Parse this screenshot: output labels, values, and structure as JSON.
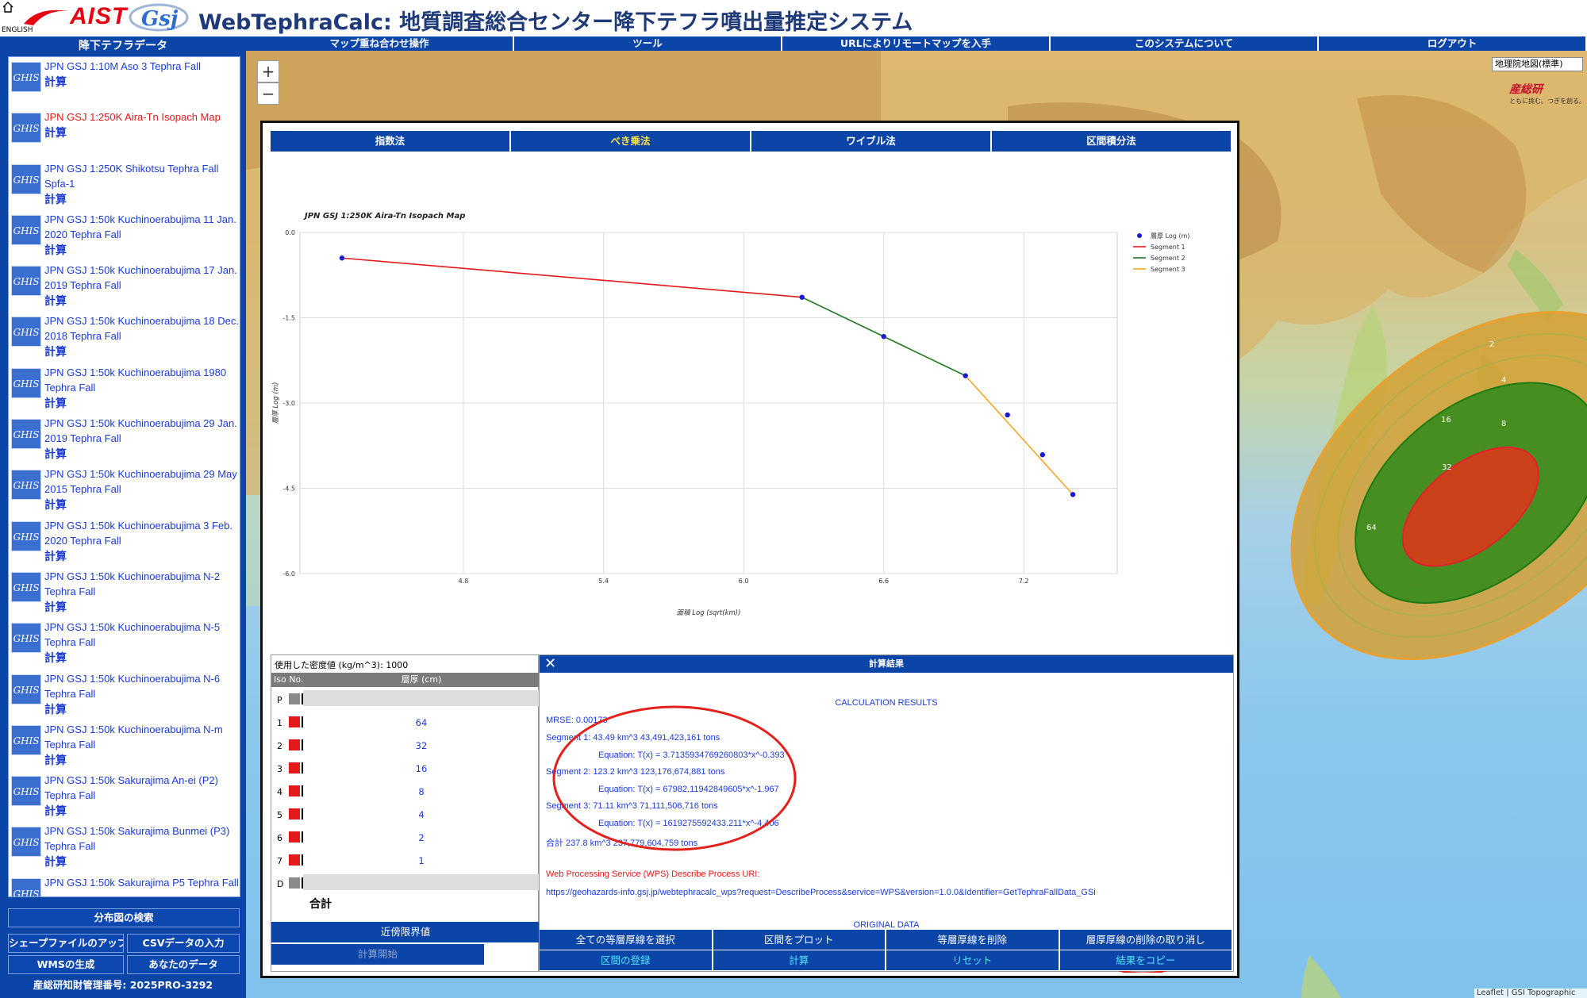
{
  "header": {
    "english_link": "ENGLISH",
    "aist_logo": "AIST",
    "title": "WebTephraCalc: 地質調査総合センター降下テフラ噴出量推定システム"
  },
  "sidebar": {
    "title": "降下テフラデータ",
    "calc_label": "計算",
    "icon_label": "GHIS",
    "datasets": [
      {
        "name": "JPN GSJ 1:10M Aso 3 Tephra Fall",
        "active": false
      },
      {
        "name": "JPN GSJ 1:250K Aira-Tn Isopach Map",
        "active": true
      },
      {
        "name": "JPN GSJ 1:250K Shikotsu Tephra Fall Spfa-1",
        "active": false
      },
      {
        "name": "JPN GSJ 1:50k Kuchinoerabujima 11 Jan. 2020 Tephra Fall",
        "active": false
      },
      {
        "name": "JPN GSJ 1:50k Kuchinoerabujima 17 Jan. 2019 Tephra Fall",
        "active": false
      },
      {
        "name": "JPN GSJ 1:50k Kuchinoerabujima 18 Dec. 2018 Tephra Fall",
        "active": false
      },
      {
        "name": "JPN GSJ 1:50k Kuchinoerabujima 1980 Tephra Fall",
        "active": false
      },
      {
        "name": "JPN GSJ 1:50k Kuchinoerabujima 29 Jan. 2019 Tephra Fall",
        "active": false
      },
      {
        "name": "JPN GSJ 1:50k Kuchinoerabujima 29 May 2015 Tephra Fall",
        "active": false
      },
      {
        "name": "JPN GSJ 1:50k Kuchinoerabujima 3 Feb. 2020 Tephra Fall",
        "active": false
      },
      {
        "name": "JPN GSJ 1:50k Kuchinoerabujima N-2 Tephra Fall",
        "active": false
      },
      {
        "name": "JPN GSJ 1:50k Kuchinoerabujima N-5 Tephra Fall",
        "active": false
      },
      {
        "name": "JPN GSJ 1:50k Kuchinoerabujima N-6 Tephra Fall",
        "active": false
      },
      {
        "name": "JPN GSJ 1:50k Kuchinoerabujima N-m Tephra Fall",
        "active": false
      },
      {
        "name": "JPN GSJ 1:50k Sakurajima An-ei (P2) Tephra Fall",
        "active": false
      },
      {
        "name": "JPN GSJ 1:50k Sakurajima Bunmei (P3) Tephra Fall",
        "active": false
      },
      {
        "name": "JPN GSJ 1:50k Sakurajima P5 Tephra Fall",
        "active": false
      }
    ],
    "search_button": "分布図の検索",
    "shapefile_button": "シェープファイルのアップロード",
    "csv_button": "CSVデータの入力",
    "wms_button": "WMSの生成",
    "your_data_button": "あなたのデータ",
    "license": "産総研知財管理番号: 2025PRO-3292"
  },
  "topnav": {
    "items": [
      "マップ重ね合わせ操作",
      "ツール",
      "URLによりリモートマップを入手",
      "このシステムについて",
      "ログアウト"
    ]
  },
  "map": {
    "zoom_in": "+",
    "zoom_out": "−",
    "basemap_selected": "地理院地図(標準)",
    "logo": "産総研",
    "logo_sub": "ともに挑む。つぎを創る。",
    "attribution": "Leaflet | GSI Topographic Map",
    "isopach_labels": [
      "2",
      "4",
      "8",
      "16",
      "32",
      "64"
    ],
    "colors": {
      "outer": "#d4a034",
      "middle": "#2e8a1a",
      "inner": "#d93a1a"
    }
  },
  "methods": {
    "tabs": [
      "指数法",
      "べき乗法",
      "ワイブル法",
      "区間積分法"
    ],
    "active_index": 1
  },
  "chart_data": {
    "type": "line",
    "title": "JPN GSJ 1:250K Aira-Tn Isopach Map",
    "xlabel": "面積 Log (sqrt(km))",
    "ylabel": "層厚 Log (m)",
    "xlim": [
      4.1,
      7.6
    ],
    "ylim": [
      -6.0,
      0.0
    ],
    "xticks": [
      "4.8",
      "5.4",
      "6.0",
      "6.6",
      "7.2"
    ],
    "xtick_values": [
      4.8,
      5.4,
      6.0,
      6.6,
      7.2
    ],
    "yticks": [
      "0.0",
      "-1.5",
      "-3.0",
      "-4.5",
      "-6.0"
    ],
    "ytick_values": [
      0.0,
      -1.5,
      -3.0,
      -4.5,
      -6.0
    ],
    "points": {
      "name": "層厚 Log (m)",
      "x": [
        4.28,
        6.25,
        6.6,
        6.95,
        7.13,
        7.28,
        7.41
      ],
      "y": [
        -0.45,
        -1.14,
        -1.83,
        -2.52,
        -3.21,
        -3.91,
        -4.61
      ],
      "color": "#1a1ad6"
    },
    "series": [
      {
        "name": "Segment 1",
        "color": "#e41a1a",
        "x": [
          4.28,
          6.25
        ],
        "y": [
          -0.45,
          -1.14
        ]
      },
      {
        "name": "Segment 2",
        "color": "#1f7a1f",
        "x": [
          6.25,
          6.95
        ],
        "y": [
          -1.14,
          -2.52
        ]
      },
      {
        "name": "Segment 3",
        "color": "#f5a623",
        "x": [
          6.95,
          7.41
        ],
        "y": [
          -2.52,
          -4.61
        ]
      }
    ],
    "legend": "top-right"
  },
  "iso_table": {
    "density": "使用した密度値 (kg/m^3): 1000",
    "col_no": "Iso No.",
    "col_thickness": "層厚 (cm)",
    "rows": [
      {
        "no": "P",
        "value": "",
        "swatch": "#8a8a8a"
      },
      {
        "no": "1",
        "value": "64",
        "swatch": "#e41a1a"
      },
      {
        "no": "2",
        "value": "32",
        "swatch": "#e41a1a"
      },
      {
        "no": "3",
        "value": "16",
        "swatch": "#e41a1a"
      },
      {
        "no": "4",
        "value": "8",
        "swatch": "#e41a1a"
      },
      {
        "no": "5",
        "value": "4",
        "swatch": "#e41a1a"
      },
      {
        "no": "6",
        "value": "2",
        "swatch": "#e41a1a"
      },
      {
        "no": "7",
        "value": "1",
        "swatch": "#e41a1a"
      },
      {
        "no": "D",
        "value": "",
        "swatch": "#8a8a8a"
      }
    ],
    "sum_label": "合計",
    "neighbor_button": "近傍限界値",
    "start_button": "計算開始"
  },
  "results": {
    "header": "計算結果",
    "close": "✕",
    "calc_title": "CALCULATION RESULTS",
    "mrse": "MRSE: 0.00173",
    "seg1": "Segment 1:  43.49 km^3    43,491,423,161 tons",
    "seg1_eq": "Equation: T(x) = 3.7135934769260803*x^-0.393",
    "seg2": "Segment 2:  123.2 km^3    123,176,674,881 tons",
    "seg2_eq": "Equation: T(x) = 67982.11942849605*x^-1.967",
    "seg3": "Segment 3:  71.11 km^3    71,111,506,716 tons",
    "seg3_eq": "Equation: T(x) = 1619275592433.211*x^-4.406",
    "total": "合計  237.8 km^3    237,779,604,759 tons",
    "wps_label": "Web Processing Service (WPS) Describe Process URI:",
    "wps_url": "https://geohazards-info.gsj.jp/webtephracalc_wps?request=DescribeProcess&service=WPS&version=1.0.0&Identifier=GetTephraFallData_GSi",
    "original_data": "ORIGINAL DATA",
    "buttons_row1": [
      "全ての等層厚線を選択",
      "区間をプロット",
      "等層厚線を削除",
      "層厚厚線の削除の取り消し"
    ],
    "buttons_row2": [
      "区間の登録",
      "計算",
      "リセット",
      "結果をコピー"
    ]
  }
}
